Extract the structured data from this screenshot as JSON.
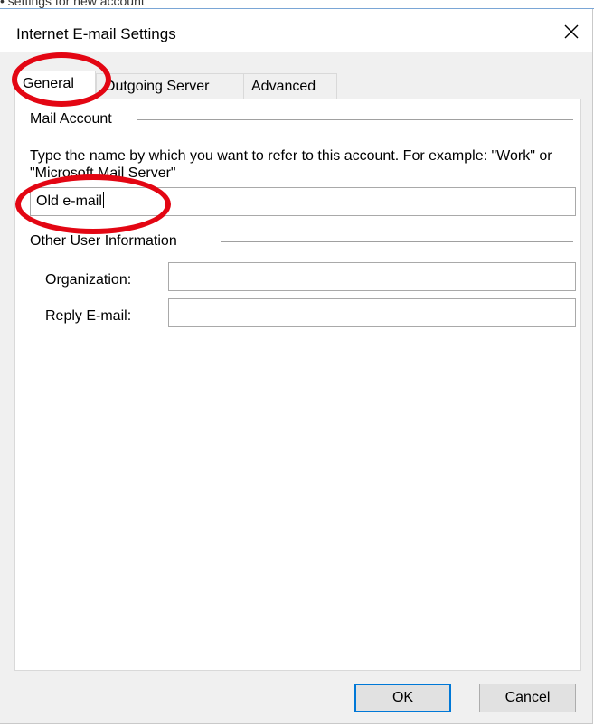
{
  "background_window": {
    "partial_title": "• settings for new account"
  },
  "dialog": {
    "title": "Internet E-mail Settings",
    "close_glyph": "✕"
  },
  "tabs": [
    {
      "label": "General",
      "active": true
    },
    {
      "label": "Outgoing Server",
      "active": false
    },
    {
      "label": "Advanced",
      "active": false
    }
  ],
  "mail_account": {
    "group_label": "Mail Account",
    "description": "Type the name by which you want to refer to this account. For example: \"Work\" or \"Microsoft Mail Server\"",
    "account_name_value": "Old e-mail"
  },
  "other_user_information": {
    "group_label": "Other User Information",
    "organization_label": "Organization:",
    "organization_value": "",
    "reply_email_label": "Reply E-mail:",
    "reply_email_value": ""
  },
  "buttons": {
    "ok_label": "OK",
    "cancel_label": "Cancel"
  },
  "colors": {
    "annotation_ring": "#e30613",
    "default_button_border": "#0078d7"
  }
}
